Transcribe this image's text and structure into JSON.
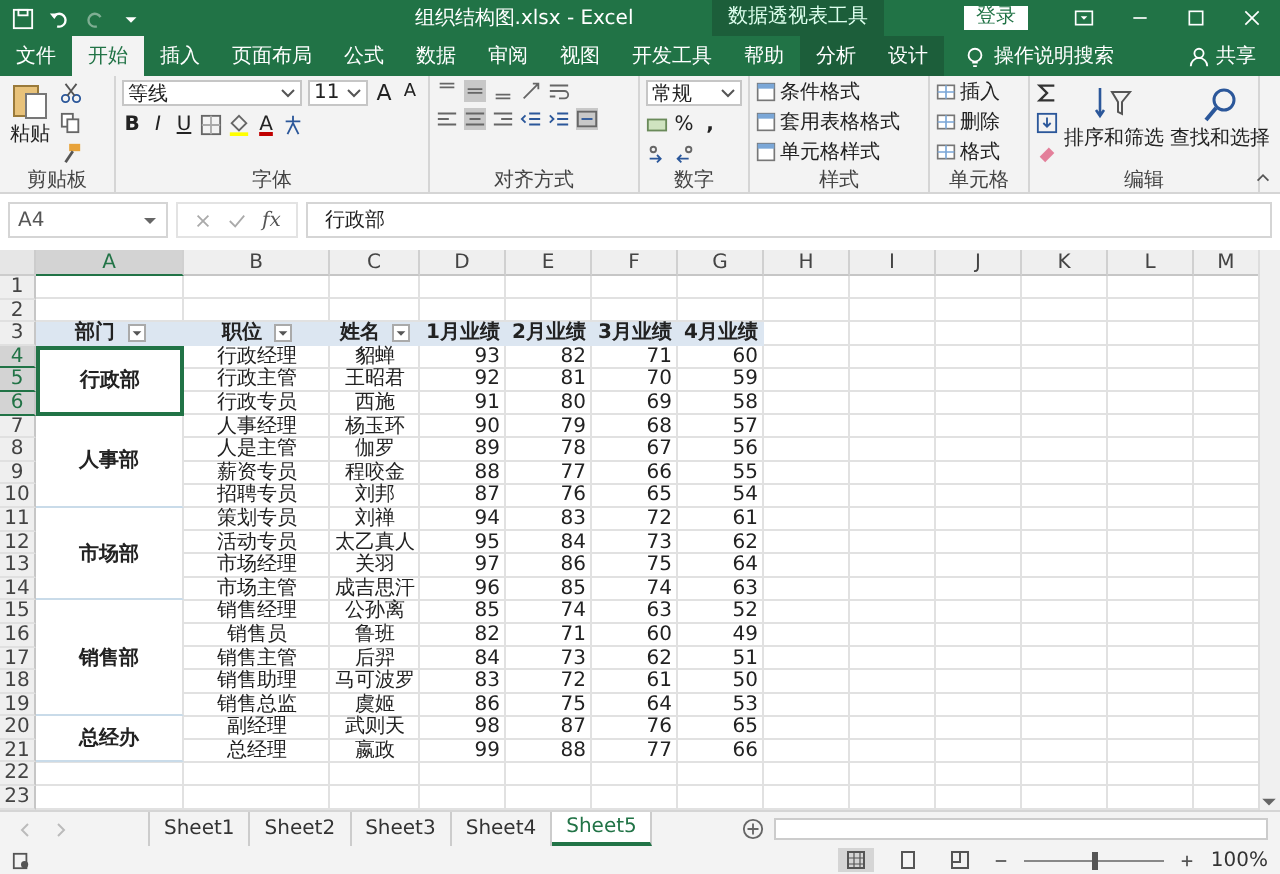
{
  "window": {
    "title": "组织结构图.xlsx  -  Excel",
    "context_group": "数据透视表工具",
    "login_button": "登录"
  },
  "ribbon_tabs": [
    {
      "label": "文件",
      "selected": false,
      "contextual": false
    },
    {
      "label": "开始",
      "selected": true,
      "contextual": false
    },
    {
      "label": "插入",
      "selected": false,
      "contextual": false
    },
    {
      "label": "页面布局",
      "selected": false,
      "contextual": false
    },
    {
      "label": "公式",
      "selected": false,
      "contextual": false
    },
    {
      "label": "数据",
      "selected": false,
      "contextual": false
    },
    {
      "label": "审阅",
      "selected": false,
      "contextual": false
    },
    {
      "label": "视图",
      "selected": false,
      "contextual": false
    },
    {
      "label": "开发工具",
      "selected": false,
      "contextual": false
    },
    {
      "label": "帮助",
      "selected": false,
      "contextual": false
    },
    {
      "label": "分析",
      "selected": false,
      "contextual": true
    },
    {
      "label": "设计",
      "selected": false,
      "contextual": true
    }
  ],
  "tell_me": "操作说明搜索",
  "share": "共享",
  "ribbon": {
    "clipboard": {
      "paste": "粘贴",
      "label": "剪贴板"
    },
    "font": {
      "name": "等线",
      "size": "11",
      "grow": "A",
      "shrink": "A",
      "bold": "B",
      "italic": "I",
      "underline": "U",
      "color_letter": "A",
      "label": "字体"
    },
    "alignment": {
      "label": "对齐方式"
    },
    "number": {
      "format": "常规",
      "percent": "%",
      "comma": ",",
      "label": "数字"
    },
    "styles": {
      "items": [
        "条件格式",
        "套用表格格式",
        "单元格样式"
      ],
      "label": "样式"
    },
    "cells": {
      "items": [
        "插入",
        "删除",
        "格式"
      ],
      "label": "单元格"
    },
    "editing": {
      "sort": "排序和筛选",
      "find": "查找和选择",
      "label": "编辑"
    }
  },
  "formula_bar": {
    "name_box": "A4",
    "fx": "fx",
    "value": "行政部"
  },
  "sheet": {
    "columns": [
      "A",
      "B",
      "C",
      "D",
      "E",
      "F",
      "G",
      "H",
      "I",
      "J",
      "K",
      "L",
      "M"
    ],
    "row_numbers": [
      "1",
      "2",
      "3",
      "4",
      "5",
      "6",
      "7",
      "8",
      "9",
      "10",
      "11",
      "12",
      "13",
      "14",
      "15",
      "16",
      "17",
      "18",
      "19",
      "20",
      "21",
      "22",
      "23"
    ],
    "header": [
      {
        "text": "部门",
        "filter": true
      },
      {
        "text": "职位",
        "filter": true
      },
      {
        "text": "姓名",
        "filter": true
      },
      {
        "text": "1月业绩",
        "filter": false
      },
      {
        "text": "2月业绩",
        "filter": false
      },
      {
        "text": "3月业绩",
        "filter": false
      },
      {
        "text": "4月业绩",
        "filter": false
      }
    ],
    "departments": [
      {
        "name": "行政部",
        "selected": true,
        "rows": [
          [
            "行政经理",
            "貂蝉",
            "93",
            "82",
            "71",
            "60"
          ],
          [
            "行政主管",
            "王昭君",
            "92",
            "81",
            "70",
            "59"
          ],
          [
            "行政专员",
            "西施",
            "91",
            "80",
            "69",
            "58"
          ]
        ]
      },
      {
        "name": "人事部",
        "selected": false,
        "rows": [
          [
            "人事经理",
            "杨玉环",
            "90",
            "79",
            "68",
            "57"
          ],
          [
            "人是主管",
            "伽罗",
            "89",
            "78",
            "67",
            "56"
          ],
          [
            "薪资专员",
            "程咬金",
            "88",
            "77",
            "66",
            "55"
          ],
          [
            "招聘专员",
            "刘邦",
            "87",
            "76",
            "65",
            "54"
          ]
        ]
      },
      {
        "name": "市场部",
        "selected": false,
        "rows": [
          [
            "策划专员",
            "刘禅",
            "94",
            "83",
            "72",
            "61"
          ],
          [
            "活动专员",
            "太乙真人",
            "95",
            "84",
            "73",
            "62"
          ],
          [
            "市场经理",
            "关羽",
            "97",
            "86",
            "75",
            "64"
          ],
          [
            "市场主管",
            "成吉思汗",
            "96",
            "85",
            "74",
            "63"
          ]
        ]
      },
      {
        "name": "销售部",
        "selected": false,
        "rows": [
          [
            "销售经理",
            "公孙离",
            "85",
            "74",
            "63",
            "52"
          ],
          [
            "销售员",
            "鲁班",
            "82",
            "71",
            "60",
            "49"
          ],
          [
            "销售主管",
            "后羿",
            "84",
            "73",
            "62",
            "51"
          ],
          [
            "销售助理",
            "马可波罗",
            "83",
            "72",
            "61",
            "50"
          ],
          [
            "销售总监",
            "虞姬",
            "86",
            "75",
            "64",
            "53"
          ]
        ]
      },
      {
        "name": "总经办",
        "selected": false,
        "rows": [
          [
            "副经理",
            "武则天",
            "98",
            "87",
            "76",
            "65"
          ],
          [
            "总经理",
            "嬴政",
            "99",
            "88",
            "77",
            "66"
          ]
        ]
      }
    ]
  },
  "sheet_tabs": [
    {
      "label": "Sheet1",
      "selected": false
    },
    {
      "label": "Sheet2",
      "selected": false
    },
    {
      "label": "Sheet3",
      "selected": false
    },
    {
      "label": "Sheet4",
      "selected": false
    },
    {
      "label": "Sheet5",
      "selected": true
    }
  ],
  "status_bar": {
    "zoom": "100%",
    "zoom_slider": {
      "level": 0.5
    }
  }
}
